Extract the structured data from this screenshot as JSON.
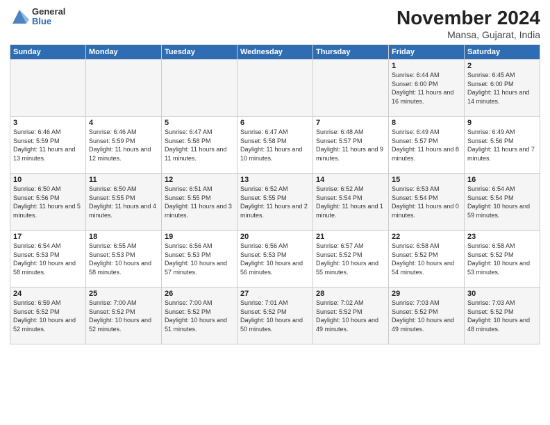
{
  "header": {
    "logo_general": "General",
    "logo_blue": "Blue",
    "title": "November 2024",
    "subtitle": "Mansa, Gujarat, India"
  },
  "days_of_week": [
    "Sunday",
    "Monday",
    "Tuesday",
    "Wednesday",
    "Thursday",
    "Friday",
    "Saturday"
  ],
  "weeks": [
    [
      {
        "day": "",
        "info": ""
      },
      {
        "day": "",
        "info": ""
      },
      {
        "day": "",
        "info": ""
      },
      {
        "day": "",
        "info": ""
      },
      {
        "day": "",
        "info": ""
      },
      {
        "day": "1",
        "info": "Sunrise: 6:44 AM\nSunset: 6:00 PM\nDaylight: 11 hours\nand 16 minutes."
      },
      {
        "day": "2",
        "info": "Sunrise: 6:45 AM\nSunset: 6:00 PM\nDaylight: 11 hours\nand 14 minutes."
      }
    ],
    [
      {
        "day": "3",
        "info": "Sunrise: 6:46 AM\nSunset: 5:59 PM\nDaylight: 11 hours\nand 13 minutes."
      },
      {
        "day": "4",
        "info": "Sunrise: 6:46 AM\nSunset: 5:59 PM\nDaylight: 11 hours\nand 12 minutes."
      },
      {
        "day": "5",
        "info": "Sunrise: 6:47 AM\nSunset: 5:58 PM\nDaylight: 11 hours\nand 11 minutes."
      },
      {
        "day": "6",
        "info": "Sunrise: 6:47 AM\nSunset: 5:58 PM\nDaylight: 11 hours\nand 10 minutes."
      },
      {
        "day": "7",
        "info": "Sunrise: 6:48 AM\nSunset: 5:57 PM\nDaylight: 11 hours\nand 9 minutes."
      },
      {
        "day": "8",
        "info": "Sunrise: 6:49 AM\nSunset: 5:57 PM\nDaylight: 11 hours\nand 8 minutes."
      },
      {
        "day": "9",
        "info": "Sunrise: 6:49 AM\nSunset: 5:56 PM\nDaylight: 11 hours\nand 7 minutes."
      }
    ],
    [
      {
        "day": "10",
        "info": "Sunrise: 6:50 AM\nSunset: 5:56 PM\nDaylight: 11 hours\nand 5 minutes."
      },
      {
        "day": "11",
        "info": "Sunrise: 6:50 AM\nSunset: 5:55 PM\nDaylight: 11 hours\nand 4 minutes."
      },
      {
        "day": "12",
        "info": "Sunrise: 6:51 AM\nSunset: 5:55 PM\nDaylight: 11 hours\nand 3 minutes."
      },
      {
        "day": "13",
        "info": "Sunrise: 6:52 AM\nSunset: 5:55 PM\nDaylight: 11 hours\nand 2 minutes."
      },
      {
        "day": "14",
        "info": "Sunrise: 6:52 AM\nSunset: 5:54 PM\nDaylight: 11 hours\nand 1 minute."
      },
      {
        "day": "15",
        "info": "Sunrise: 6:53 AM\nSunset: 5:54 PM\nDaylight: 11 hours\nand 0 minutes."
      },
      {
        "day": "16",
        "info": "Sunrise: 6:54 AM\nSunset: 5:54 PM\nDaylight: 10 hours\nand 59 minutes."
      }
    ],
    [
      {
        "day": "17",
        "info": "Sunrise: 6:54 AM\nSunset: 5:53 PM\nDaylight: 10 hours\nand 58 minutes."
      },
      {
        "day": "18",
        "info": "Sunrise: 6:55 AM\nSunset: 5:53 PM\nDaylight: 10 hours\nand 58 minutes."
      },
      {
        "day": "19",
        "info": "Sunrise: 6:56 AM\nSunset: 5:53 PM\nDaylight: 10 hours\nand 57 minutes."
      },
      {
        "day": "20",
        "info": "Sunrise: 6:56 AM\nSunset: 5:53 PM\nDaylight: 10 hours\nand 56 minutes."
      },
      {
        "day": "21",
        "info": "Sunrise: 6:57 AM\nSunset: 5:52 PM\nDaylight: 10 hours\nand 55 minutes."
      },
      {
        "day": "22",
        "info": "Sunrise: 6:58 AM\nSunset: 5:52 PM\nDaylight: 10 hours\nand 54 minutes."
      },
      {
        "day": "23",
        "info": "Sunrise: 6:58 AM\nSunset: 5:52 PM\nDaylight: 10 hours\nand 53 minutes."
      }
    ],
    [
      {
        "day": "24",
        "info": "Sunrise: 6:59 AM\nSunset: 5:52 PM\nDaylight: 10 hours\nand 52 minutes."
      },
      {
        "day": "25",
        "info": "Sunrise: 7:00 AM\nSunset: 5:52 PM\nDaylight: 10 hours\nand 52 minutes."
      },
      {
        "day": "26",
        "info": "Sunrise: 7:00 AM\nSunset: 5:52 PM\nDaylight: 10 hours\nand 51 minutes."
      },
      {
        "day": "27",
        "info": "Sunrise: 7:01 AM\nSunset: 5:52 PM\nDaylight: 10 hours\nand 50 minutes."
      },
      {
        "day": "28",
        "info": "Sunrise: 7:02 AM\nSunset: 5:52 PM\nDaylight: 10 hours\nand 49 minutes."
      },
      {
        "day": "29",
        "info": "Sunrise: 7:03 AM\nSunset: 5:52 PM\nDaylight: 10 hours\nand 49 minutes."
      },
      {
        "day": "30",
        "info": "Sunrise: 7:03 AM\nSunset: 5:52 PM\nDaylight: 10 hours\nand 48 minutes."
      }
    ]
  ]
}
